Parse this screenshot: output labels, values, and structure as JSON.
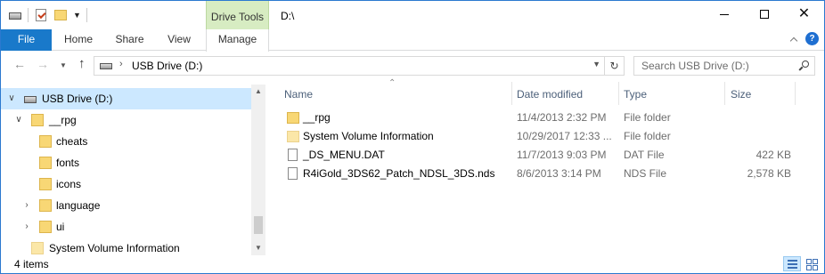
{
  "titlebar": {
    "contextual_group": "Drive Tools",
    "window_title": "D:\\"
  },
  "ribbon": {
    "tabs": {
      "file": "File",
      "home": "Home",
      "share": "Share",
      "view": "View",
      "manage": "Manage"
    },
    "help": "?"
  },
  "nav": {
    "address": "USB Drive (D:)",
    "search_placeholder": "Search USB Drive (D:)"
  },
  "tree": {
    "items": [
      {
        "label": "USB Drive (D:)",
        "selected": true
      },
      {
        "label": "__rpg"
      },
      {
        "label": "cheats"
      },
      {
        "label": "fonts"
      },
      {
        "label": "icons"
      },
      {
        "label": "language"
      },
      {
        "label": "ui"
      },
      {
        "label": "System Volume Information"
      }
    ]
  },
  "columns": {
    "name": "Name",
    "date": "Date modified",
    "type": "Type",
    "size": "Size"
  },
  "files": [
    {
      "name": "__rpg",
      "date": "11/4/2013 2:32 PM",
      "type": "File folder",
      "size": "",
      "icon": "folder-icon"
    },
    {
      "name": "System Volume Information",
      "date": "10/29/2017 12:33 ...",
      "type": "File folder",
      "size": "",
      "icon": "folder-icon"
    },
    {
      "name": "_DS_MENU.DAT",
      "date": "11/7/2013 9:03 PM",
      "type": "DAT File",
      "size": "422 KB",
      "icon": "file-icon"
    },
    {
      "name": "R4iGold_3DS62_Patch_NDSL_3DS.nds",
      "date": "8/6/2013 3:14 PM",
      "type": "NDS File",
      "size": "2,578 KB",
      "icon": "file-icon"
    }
  ],
  "status": {
    "item_count": "4 items"
  }
}
